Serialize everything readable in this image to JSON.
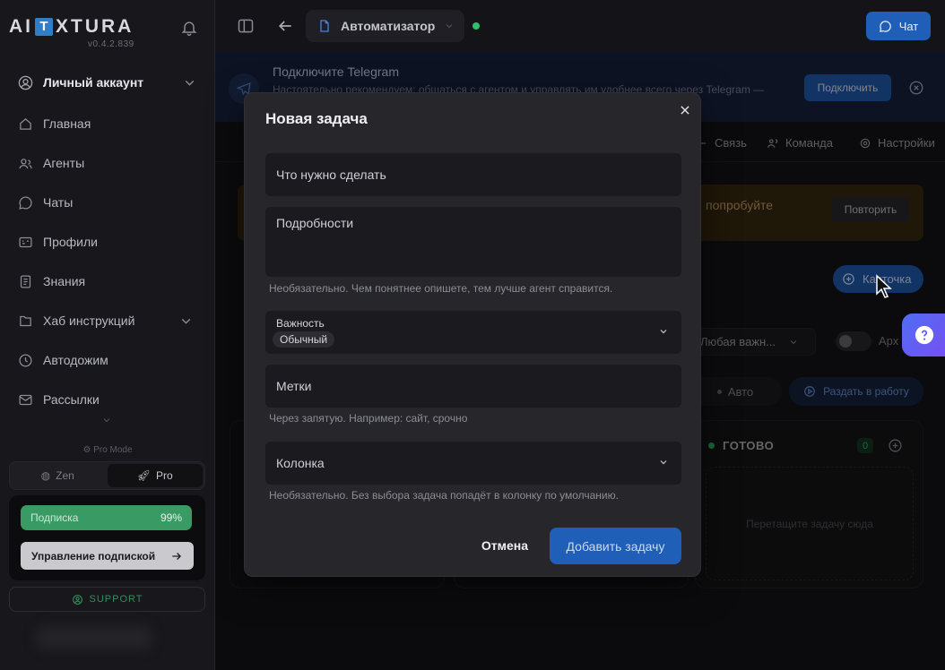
{
  "sidebar": {
    "logo": {
      "left": "AI",
      "mid": "T",
      "right": "XTURA"
    },
    "version": "v0.4.2.839",
    "account_label": "Личный аккаунт",
    "items": [
      {
        "label": "Главная",
        "icon": "home-icon"
      },
      {
        "label": "Агенты",
        "icon": "agents-icon"
      },
      {
        "label": "Чаты",
        "icon": "chat-icon"
      },
      {
        "label": "Профили",
        "icon": "profile-card-icon"
      },
      {
        "label": "Знания",
        "icon": "book-icon"
      },
      {
        "label": "Хаб инструкций",
        "icon": "hub-icon"
      },
      {
        "label": "Автодожим",
        "icon": "clock-icon"
      },
      {
        "label": "Рассылки",
        "icon": "mail-icon"
      }
    ],
    "pro_mode_label": "Pro Mode",
    "modes": {
      "zen": "Zen",
      "pro": "Pro"
    },
    "subscription": {
      "label": "Подписка",
      "percent": "99%"
    },
    "manage_label": "Управление подпиской",
    "support_label": "SUPPORT"
  },
  "topbar": {
    "agent_name": "Автоматизатор",
    "chat_label": "Чат"
  },
  "telegram_banner": {
    "title": "Подключите Telegram",
    "text": "Настоятельно рекомендуем: общаться с агентом и управлять им удобнее всего через Telegram —",
    "connect_label": "Подключить"
  },
  "tabs": [
    {
      "label": "Связь"
    },
    {
      "label": "Команда"
    },
    {
      "label": "Настройки"
    }
  ],
  "background": {
    "error_text": "попробуйте",
    "retry_label": "Повторить",
    "card_button_label": "Карточка",
    "priority_filter": "Любая важн...",
    "archive_label": "Арх",
    "auto_label": "Авто",
    "distribute_label": "Раздать в работу",
    "done_column": {
      "title": "ГОТОВО",
      "count": "0",
      "drop_hint": "Перетащите задачу сюда"
    }
  },
  "modal": {
    "title": "Новая задача",
    "task_placeholder": "Что нужно сделать",
    "details_placeholder": "Подробности",
    "details_hint": "Необязательно. Чем понятнее опишете, тем лучше агент справится.",
    "priority_label": "Важность",
    "priority_value": "Обычный",
    "tags_placeholder": "Метки",
    "tags_hint": "Через запятую. Например: сайт, срочно",
    "column_label": "Колонка",
    "column_hint": "Необязательно. Без выбора задача попадёт в колонку по умолчанию.",
    "cancel_label": "Отмена",
    "submit_label": "Добавить задачу"
  },
  "colors": {
    "accent": "#1f5fb8",
    "success": "#2fbf6a",
    "subscription_bar": "#3a9a63"
  }
}
